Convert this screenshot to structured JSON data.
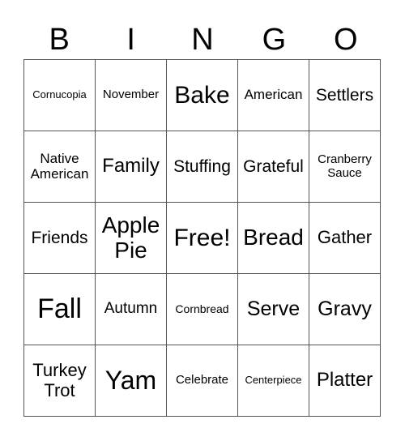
{
  "header": [
    "B",
    "I",
    "N",
    "G",
    "O"
  ],
  "cells": [
    [
      "Cornucopia",
      "November",
      "Bake",
      "American",
      "Settlers"
    ],
    [
      "Native American",
      "Family",
      "Stuffing",
      "Grateful",
      "Cranberry Sauce"
    ],
    [
      "Friends",
      "Apple Pie",
      "Free!",
      "Bread",
      "Gather"
    ],
    [
      "Fall",
      "Autumn",
      "Cornbread",
      "Serve",
      "Gravy"
    ],
    [
      "Turkey Trot",
      "Yam",
      "Celebrate",
      "Centerpiece",
      "Platter"
    ]
  ]
}
